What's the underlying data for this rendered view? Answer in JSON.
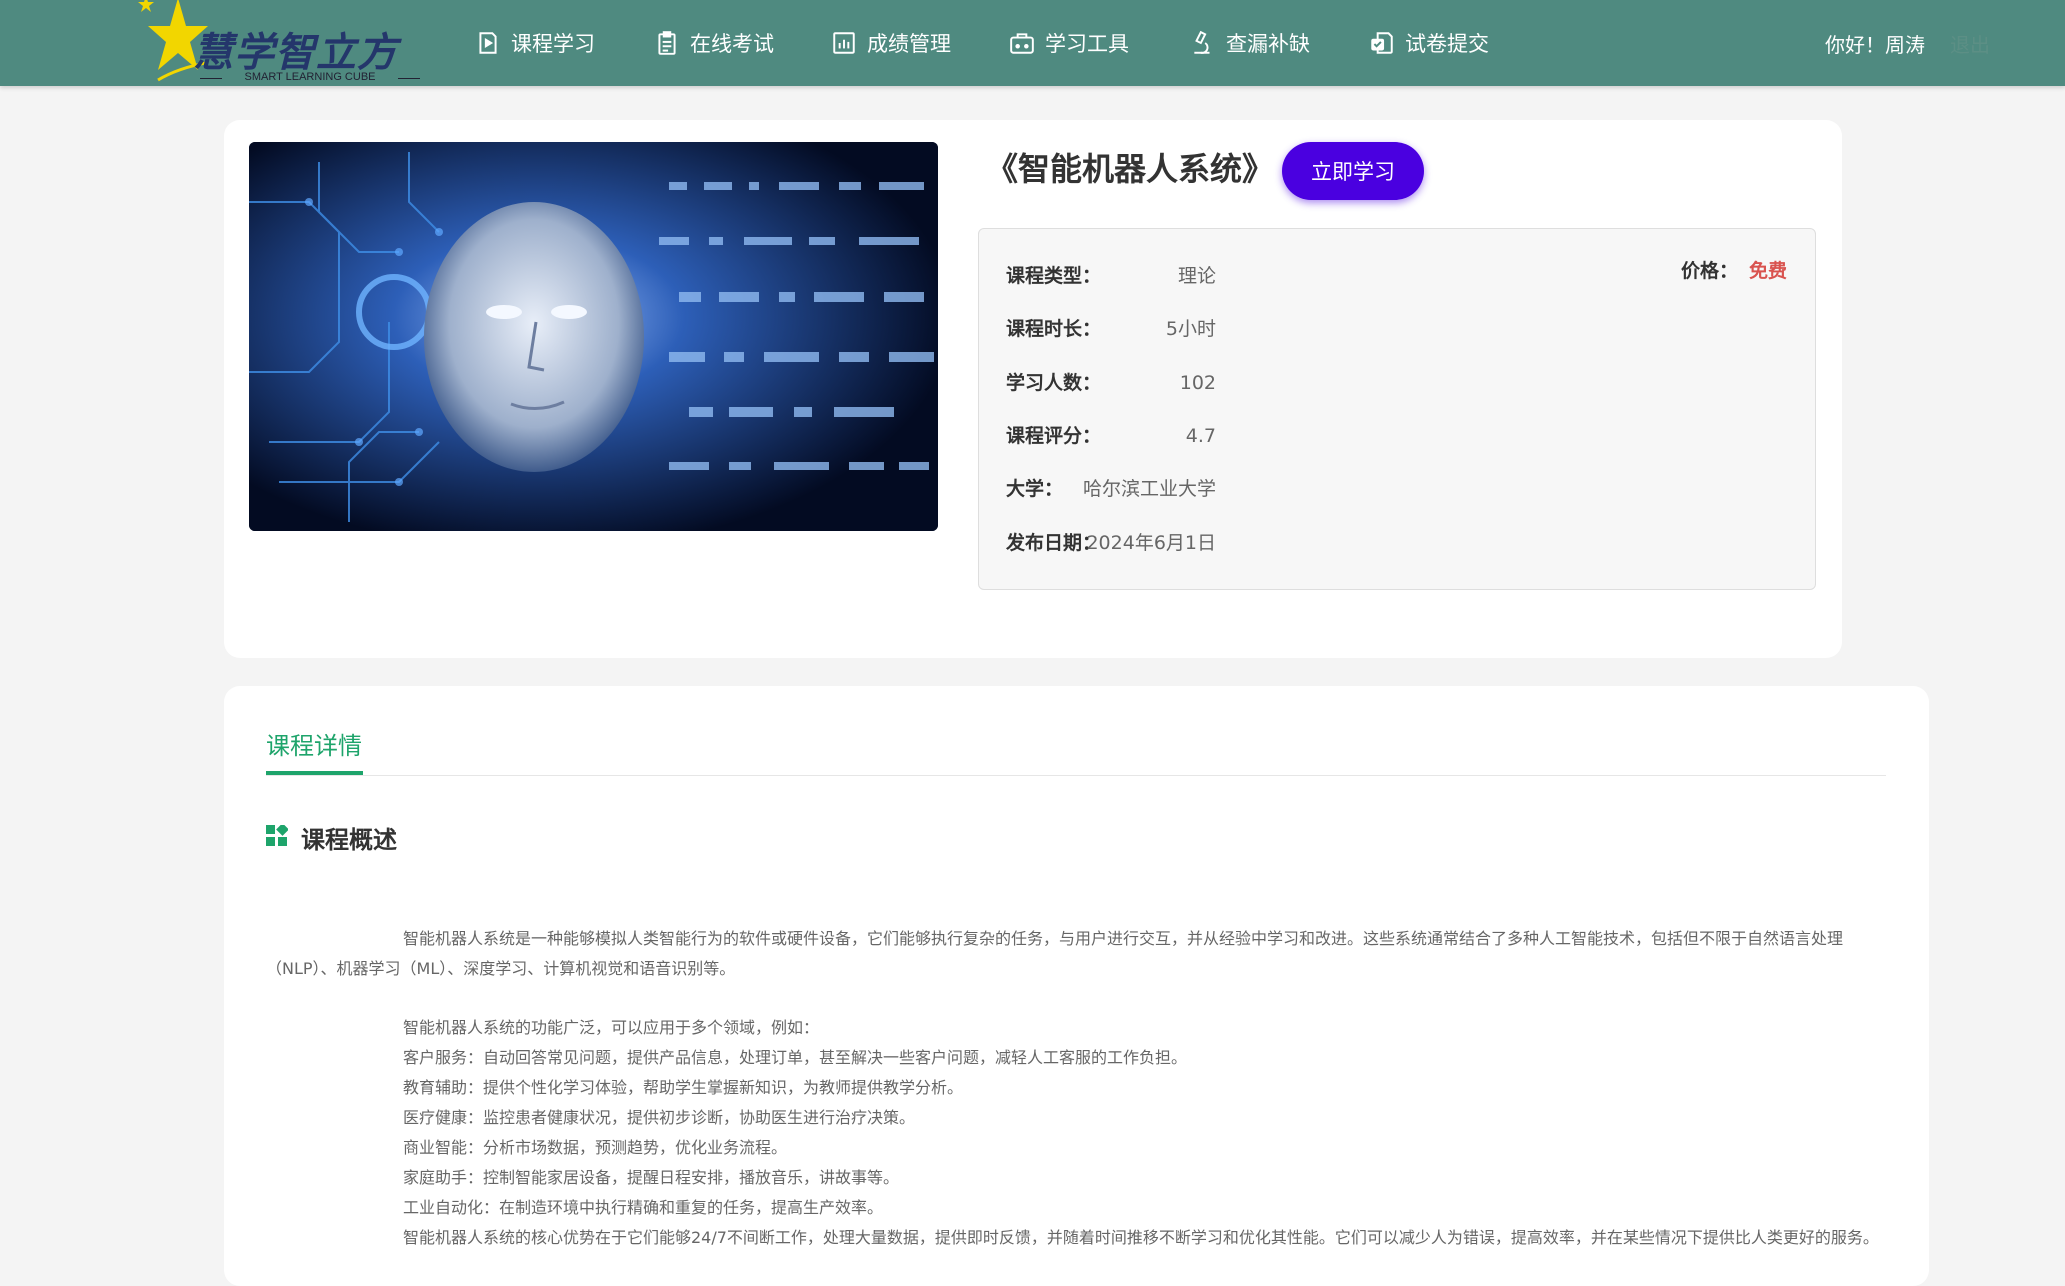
{
  "header": {
    "logo_title": "慧学智立方",
    "logo_subtitle": "SMART LEARNING CUBE",
    "nav": [
      {
        "label": "课程学习",
        "icon": "play-document-icon"
      },
      {
        "label": "在线考试",
        "icon": "clipboard-icon"
      },
      {
        "label": "成绩管理",
        "icon": "bar-chart-icon"
      },
      {
        "label": "学习工具",
        "icon": "toolbox-icon"
      },
      {
        "label": "查漏补缺",
        "icon": "microscope-icon"
      },
      {
        "label": "试卷提交",
        "icon": "submit-paper-icon"
      }
    ],
    "greeting": "你好！周涛",
    "logout": "退出"
  },
  "course": {
    "cover_alt": "智能机器人系统课程封面",
    "title": "《智能机器人系统》",
    "study_button": "立即学习",
    "info": {
      "type_label": "课程类型：",
      "type_value": "理论",
      "duration_label": "课程时长：",
      "duration_value": "5小时",
      "learners_label": "学习人数：",
      "learners_value": "102",
      "rating_label": "课程评分：",
      "rating_value": "4.7",
      "university_label": "大学：",
      "university_value": "哈尔滨工业大学",
      "date_label": "发布日期：",
      "date_value": "2024年6月1日",
      "price_label": "价格：",
      "price_value": "免费"
    }
  },
  "detail": {
    "tab_label": "课程详情",
    "section_title": "课程概述",
    "paragraph1": "智能机器人系统是一种能够模拟人类智能行为的软件或硬件设备，它们能够执行复杂的任务，与用户进行交互，并从经验中学习和改进。这些系统通常结合了多种人工智能技术，包括但不限于自然语言处理（NLP）、机器学习（ML）、深度学习、计算机视觉和语音识别等。",
    "paragraph2_intro": "智能机器人系统的功能广泛，可以应用于多个领域，例如：",
    "applications": [
      "客户服务：自动回答常见问题，提供产品信息，处理订单，甚至解决一些客户问题，减轻人工客服的工作负担。",
      "教育辅助：提供个性化学习体验，帮助学生掌握新知识，为教师提供教学分析。",
      "医疗健康：监控患者健康状况，提供初步诊断，协助医生进行治疗决策。",
      "商业智能：分析市场数据，预测趋势，优化业务流程。",
      "家庭助手：控制智能家居设备，提醒日程安排，播放音乐，讲故事等。",
      "工业自动化：在制造环境中执行精确和重复的任务，提高生产效率。"
    ],
    "paragraph3": "智能机器人系统的核心优势在于它们能够24/7不间断工作，处理大量数据，提供即时反馈，并随着时间推移不断学习和优化其性能。它们可以减少人为错误，提高效率，并在某些情况下提供比人类更好的服务。"
  },
  "colors": {
    "header_bg": "#4f8a80",
    "accent_green": "#1ea46b",
    "button_purple": "#4a00e0",
    "price_red": "#d9534f"
  }
}
